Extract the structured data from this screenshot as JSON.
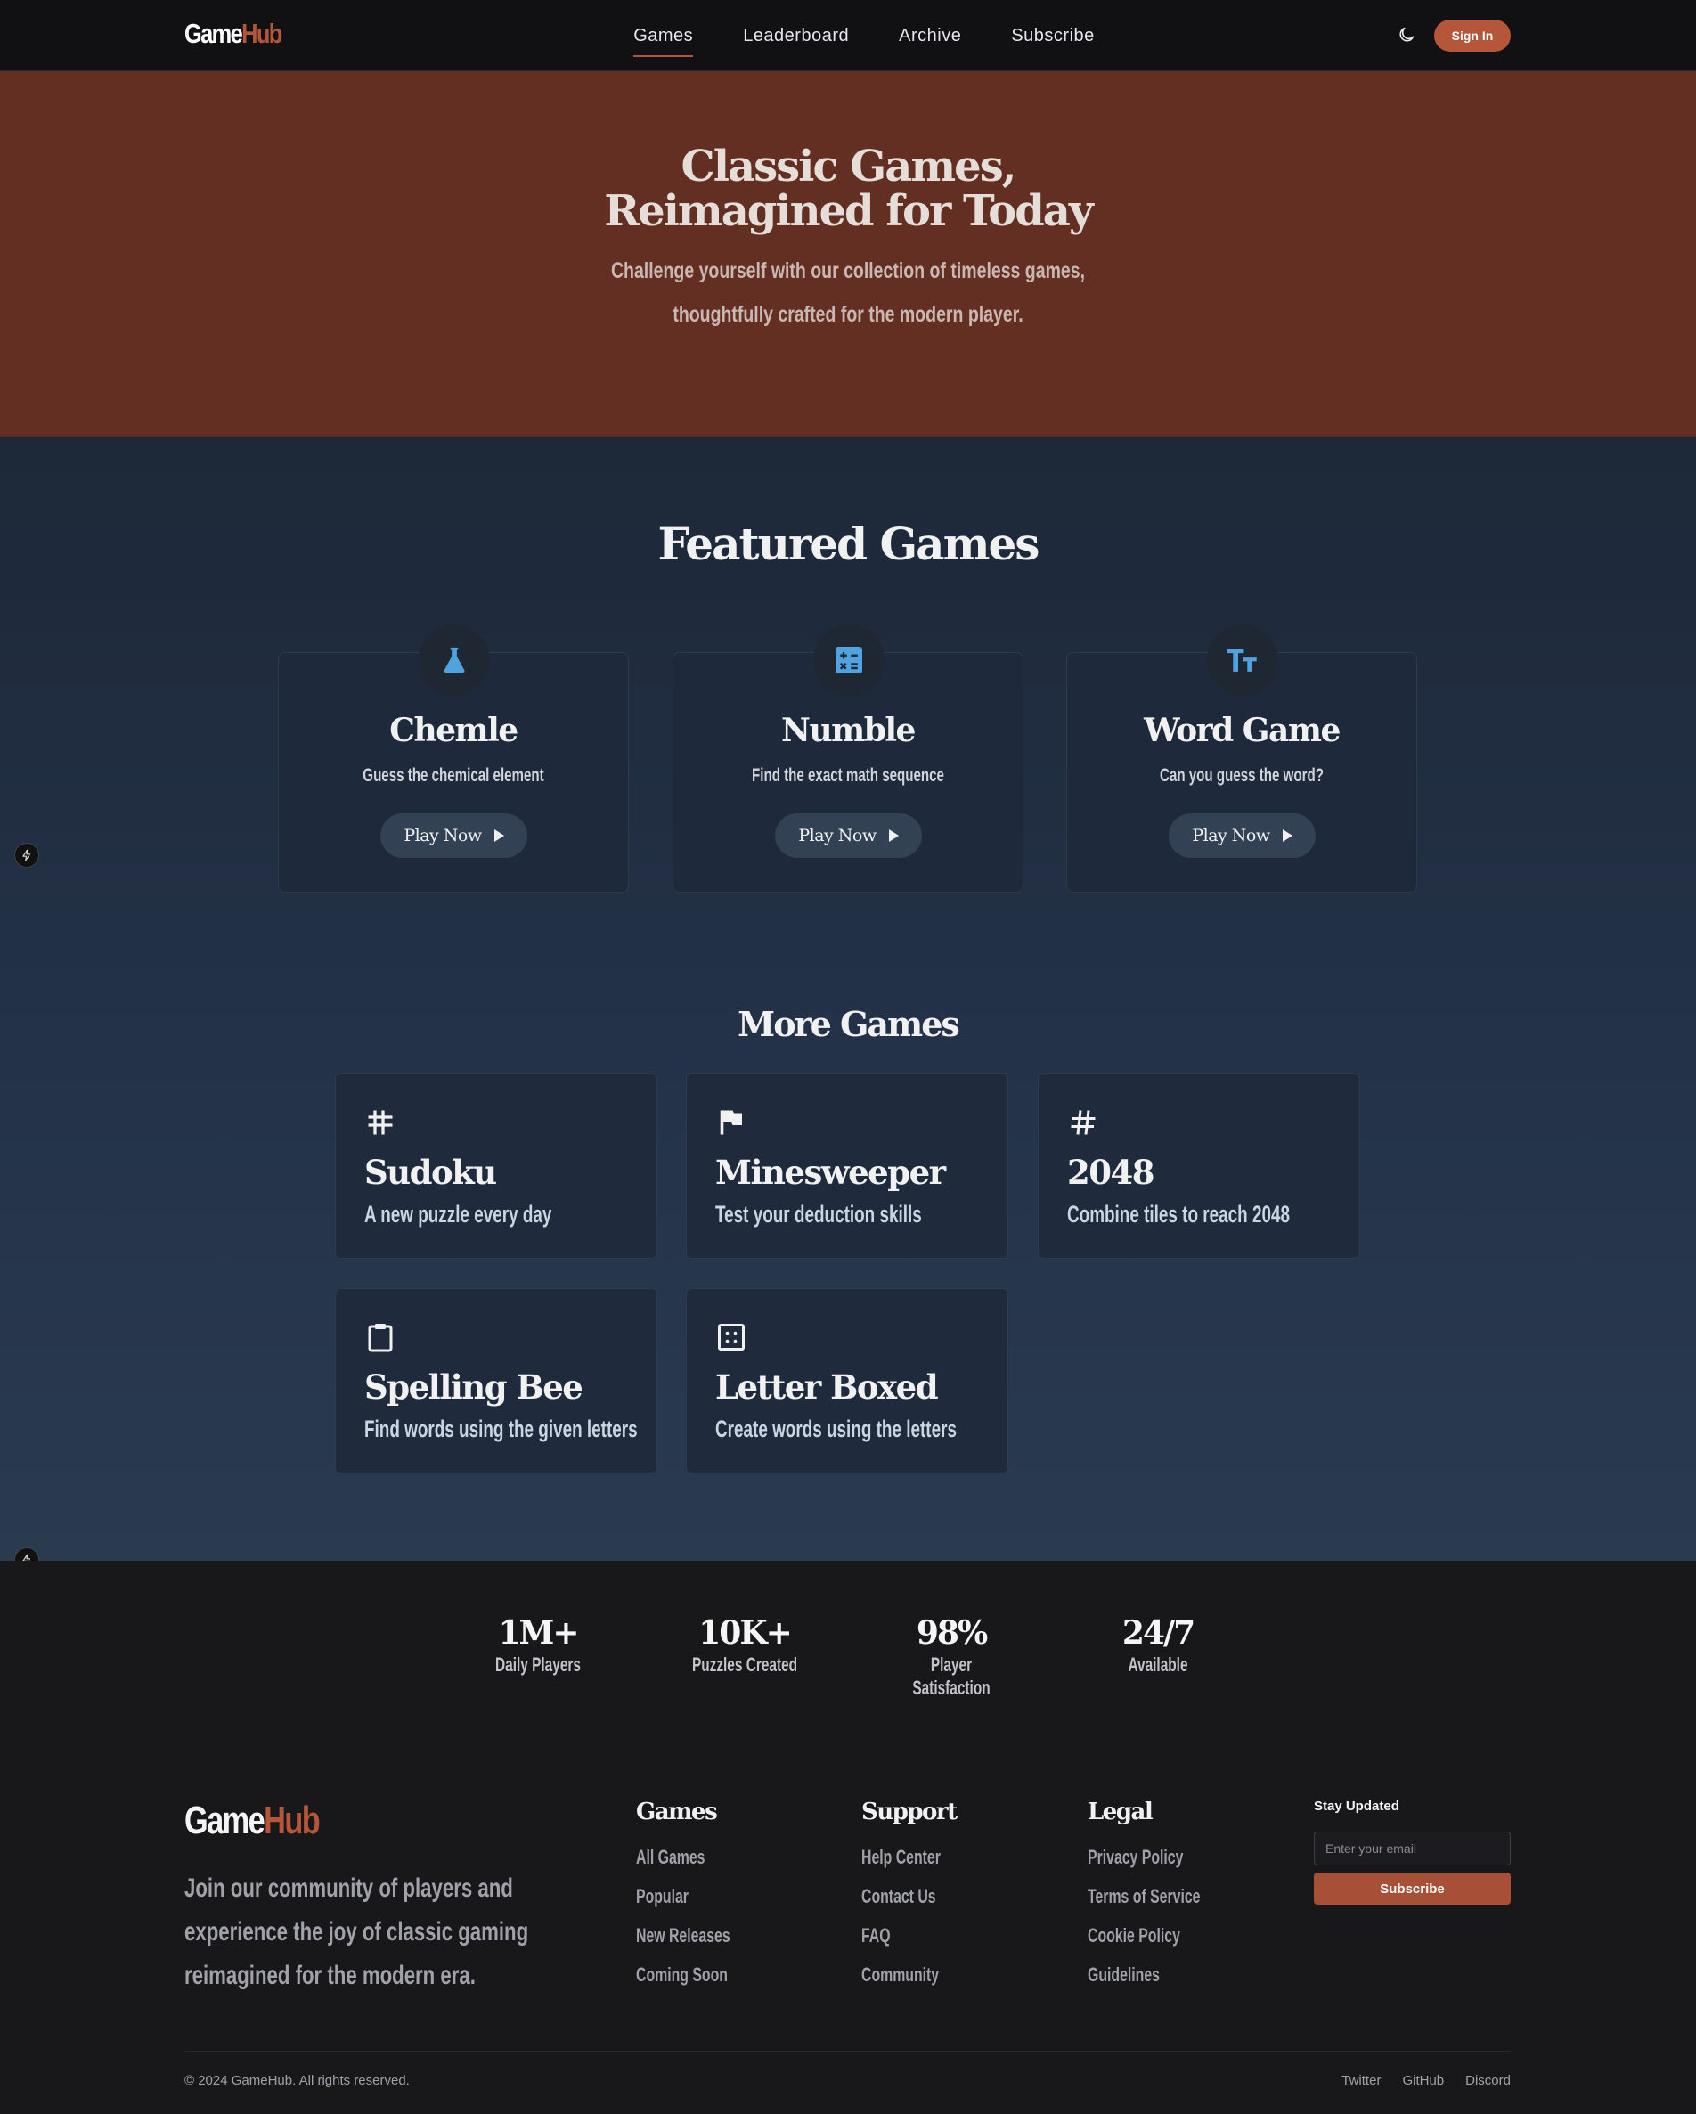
{
  "nav": {
    "logo_a": "Game",
    "logo_b": "Hub",
    "links": [
      "Games",
      "Leaderboard",
      "Archive",
      "Subscribe"
    ],
    "active": "Games",
    "sign_in": "Sign In"
  },
  "hero": {
    "title_line1": "Classic Games,",
    "title_line2": "Reimagined for Today",
    "subtitle": "Challenge yourself with our collection of timeless games, thoughtfully crafted for the modern player."
  },
  "featured": {
    "title": "Featured Games",
    "cards": [
      {
        "name": "Chemle",
        "desc": "Guess the chemical element",
        "cta": "Play Now",
        "icon": "flask-icon"
      },
      {
        "name": "Numble",
        "desc": "Find the exact math sequence",
        "cta": "Play Now",
        "icon": "calculator-icon"
      },
      {
        "name": "Word Game",
        "desc": "Can you guess the word?",
        "cta": "Play Now",
        "icon": "text-size-icon"
      }
    ]
  },
  "more": {
    "title": "More Games",
    "cards": [
      {
        "name": "Sudoku",
        "desc": "A new puzzle every day",
        "icon": "grid-hash-icon"
      },
      {
        "name": "Minesweeper",
        "desc": "Test your deduction skills",
        "icon": "flag-icon"
      },
      {
        "name": "2048",
        "desc": "Combine tiles to reach 2048",
        "icon": "hash-icon"
      },
      {
        "name": "Spelling Bee",
        "desc": "Find words using the given letters",
        "icon": "clipboard-icon"
      },
      {
        "name": "Letter Boxed",
        "desc": "Create words using the letters",
        "icon": "dotted-square-icon"
      }
    ]
  },
  "stats": [
    {
      "value": "1M+",
      "label": "Daily Players"
    },
    {
      "value": "10K+",
      "label": "Puzzles Created"
    },
    {
      "value": "98%",
      "label": "Player Satisfaction"
    },
    {
      "value": "24/7",
      "label": "Available"
    }
  ],
  "footer": {
    "logo_a": "Game",
    "logo_b": "Hub",
    "about": "Join our community of players and experience the joy of classic gaming reimagined for the modern era.",
    "columns": [
      {
        "title": "Games",
        "links": [
          "All Games",
          "Popular",
          "New Releases",
          "Coming Soon"
        ]
      },
      {
        "title": "Support",
        "links": [
          "Help Center",
          "Contact Us",
          "FAQ",
          "Community"
        ]
      },
      {
        "title": "Legal",
        "links": [
          "Privacy Policy",
          "Terms of Service",
          "Cookie Policy",
          "Guidelines"
        ]
      }
    ],
    "stay_updated": "Stay Updated",
    "email_placeholder": "Enter your email",
    "subscribe": "Subscribe",
    "copyright": "© 2024 GameHub. All rights reserved.",
    "social": [
      "Twitter",
      "GitHub",
      "Discord"
    ]
  },
  "colors": {
    "accent": "#b5563a",
    "hero_bg": "#642f23",
    "icon_blue": "#4ea3e0"
  }
}
